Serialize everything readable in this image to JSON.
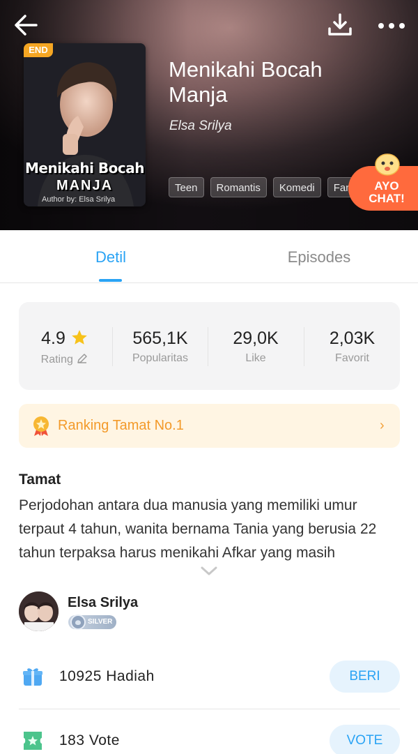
{
  "header": {
    "cover_badge": "END",
    "cover_title": "Menikahi Bocah",
    "cover_subtitle": "MANJA",
    "cover_author": "Author by: Elsa Srilya",
    "title": "Menikahi Bocah Manja",
    "author": "Elsa Srilya",
    "tags": [
      "Teen",
      "Romantis",
      "Komedi",
      "Fant"
    ],
    "chat_label_1": "AYO",
    "chat_label_2": "CHAT!"
  },
  "tabs": [
    {
      "label": "Detil",
      "active": true
    },
    {
      "label": "Episodes",
      "active": false
    }
  ],
  "stats": [
    {
      "value": "4.9",
      "label": "Rating"
    },
    {
      "value": "565,1K",
      "label": "Popularitas"
    },
    {
      "value": "29,0K",
      "label": "Like"
    },
    {
      "value": "2,03K",
      "label": "Favorit"
    }
  ],
  "ranking": {
    "label": "Ranking Tamat No.1"
  },
  "status": "Tamat",
  "synopsis": "Perjodohan antara dua manusia yang memiliki umur terpaut  4 tahun, wanita bernama Tania yang berusia 22 tahun terpaksa harus menikahi Afkar yang masih",
  "author_info": {
    "name": "Elsa Srilya",
    "badge": "SILVER"
  },
  "gift": {
    "text": "10925 Hadiah",
    "button": "BERI"
  },
  "vote": {
    "text": "183 Vote",
    "button": "VOTE"
  },
  "colors": {
    "accent": "#2aa3f4",
    "ranking": "#f39a2a",
    "chat": "#ff6a3d",
    "end_badge": "#f5a623"
  },
  "icons": [
    "back-arrow-icon",
    "download-icon",
    "more-icon",
    "star-icon",
    "edit-icon",
    "medal-icon",
    "chevron-right-icon",
    "chevron-down-icon",
    "gift-icon",
    "vote-ticket-icon",
    "silver-badge-icon"
  ]
}
